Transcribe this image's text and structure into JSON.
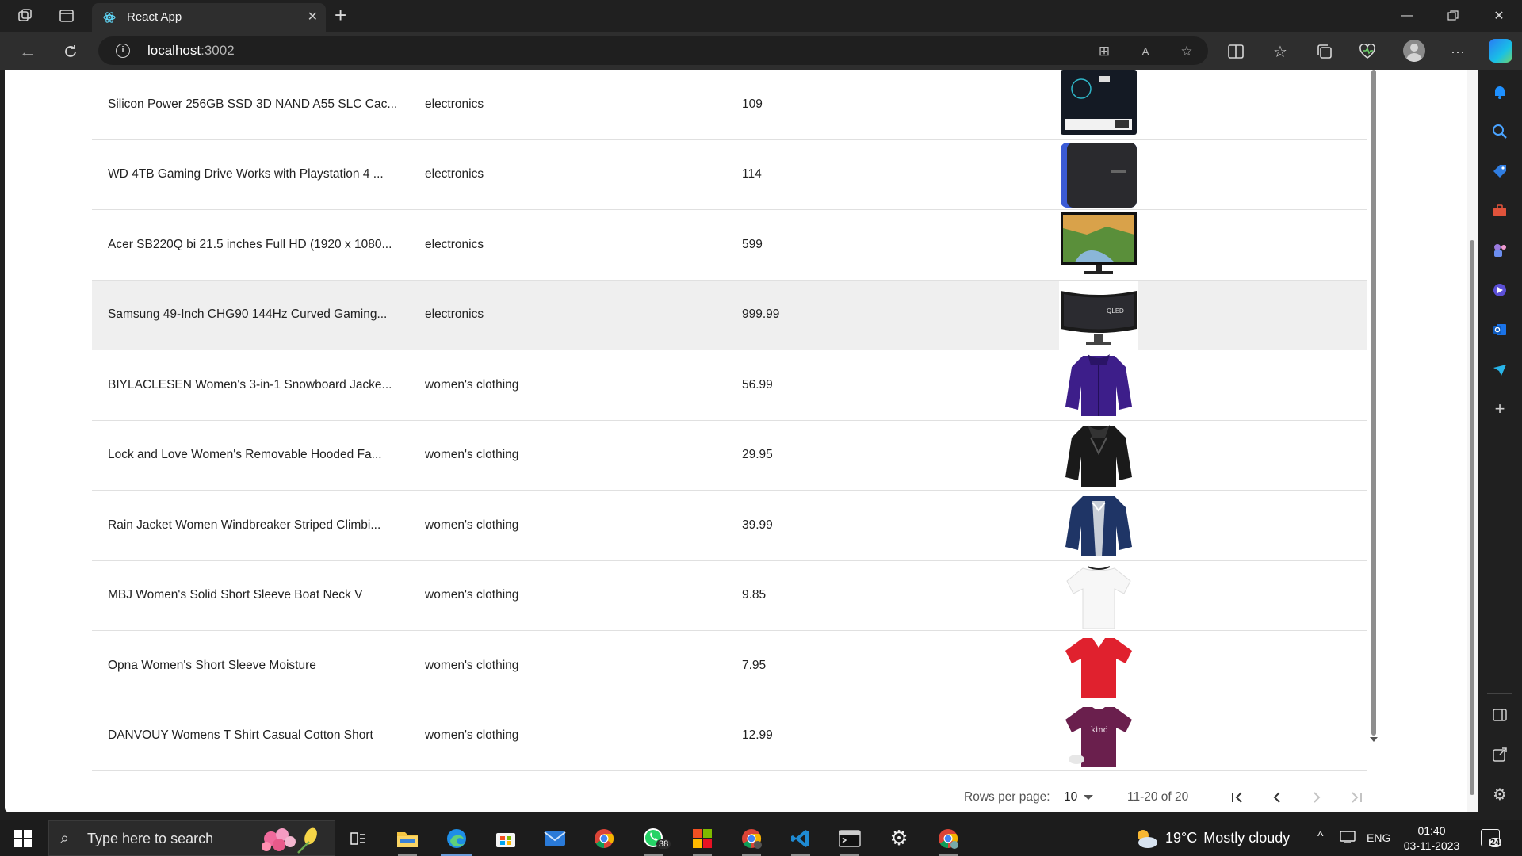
{
  "browser": {
    "tab_title": "React App",
    "url_host": "localhost",
    "url_port": ":3002"
  },
  "table": {
    "rows": [
      {
        "title": "Silicon Power 256GB SSD 3D NAND A55 SLC Cac...",
        "category": "electronics",
        "price": "109",
        "image": "ssd-drive"
      },
      {
        "title": "WD 4TB Gaming Drive Works with Playstation 4 ...",
        "category": "electronics",
        "price": "114",
        "image": "external-hard-drive"
      },
      {
        "title": "Acer SB220Q bi 21.5 inches Full HD (1920 x 1080...",
        "category": "electronics",
        "price": "599",
        "image": "monitor"
      },
      {
        "title": "Samsung 49-Inch CHG90 144Hz Curved Gaming...",
        "category": "electronics",
        "price": "999.99",
        "image": "curved-monitor"
      },
      {
        "title": "BIYLACLESEN Women's 3-in-1 Snowboard Jacke...",
        "category": "women's clothing",
        "price": "56.99",
        "image": "purple-jacket"
      },
      {
        "title": "Lock and Love Women's Removable Hooded Fa...",
        "category": "women's clothing",
        "price": "29.95",
        "image": "black-leather-jacket"
      },
      {
        "title": "Rain Jacket Women Windbreaker Striped Climbi...",
        "category": "women's clothing",
        "price": "39.99",
        "image": "navy-jacket"
      },
      {
        "title": "MBJ Women's Solid Short Sleeve Boat Neck V",
        "category": "women's clothing",
        "price": "9.85",
        "image": "white-top"
      },
      {
        "title": "Opna Women's Short Sleeve Moisture",
        "category": "women's clothing",
        "price": "7.95",
        "image": "red-tshirt"
      },
      {
        "title": "DANVOUY Womens T Shirt Casual Cotton Short",
        "category": "women's clothing",
        "price": "12.99",
        "image": "purple-tshirt"
      }
    ],
    "hover_row": 3
  },
  "pagination": {
    "rows_per_page_label": "Rows per page:",
    "rows_per_page_value": "10",
    "range_label": "11-20 of 20"
  },
  "taskbar": {
    "search_placeholder": "Type here to search",
    "whatsapp_badge": "38",
    "weather_temp": "19°C",
    "weather_desc": "Mostly cloudy",
    "language": "ENG",
    "time": "01:40",
    "date": "03-11-2023",
    "notification_count": "24"
  },
  "colors": {
    "accent_edge": "#1e90ff",
    "row_hover": "#efefef"
  }
}
